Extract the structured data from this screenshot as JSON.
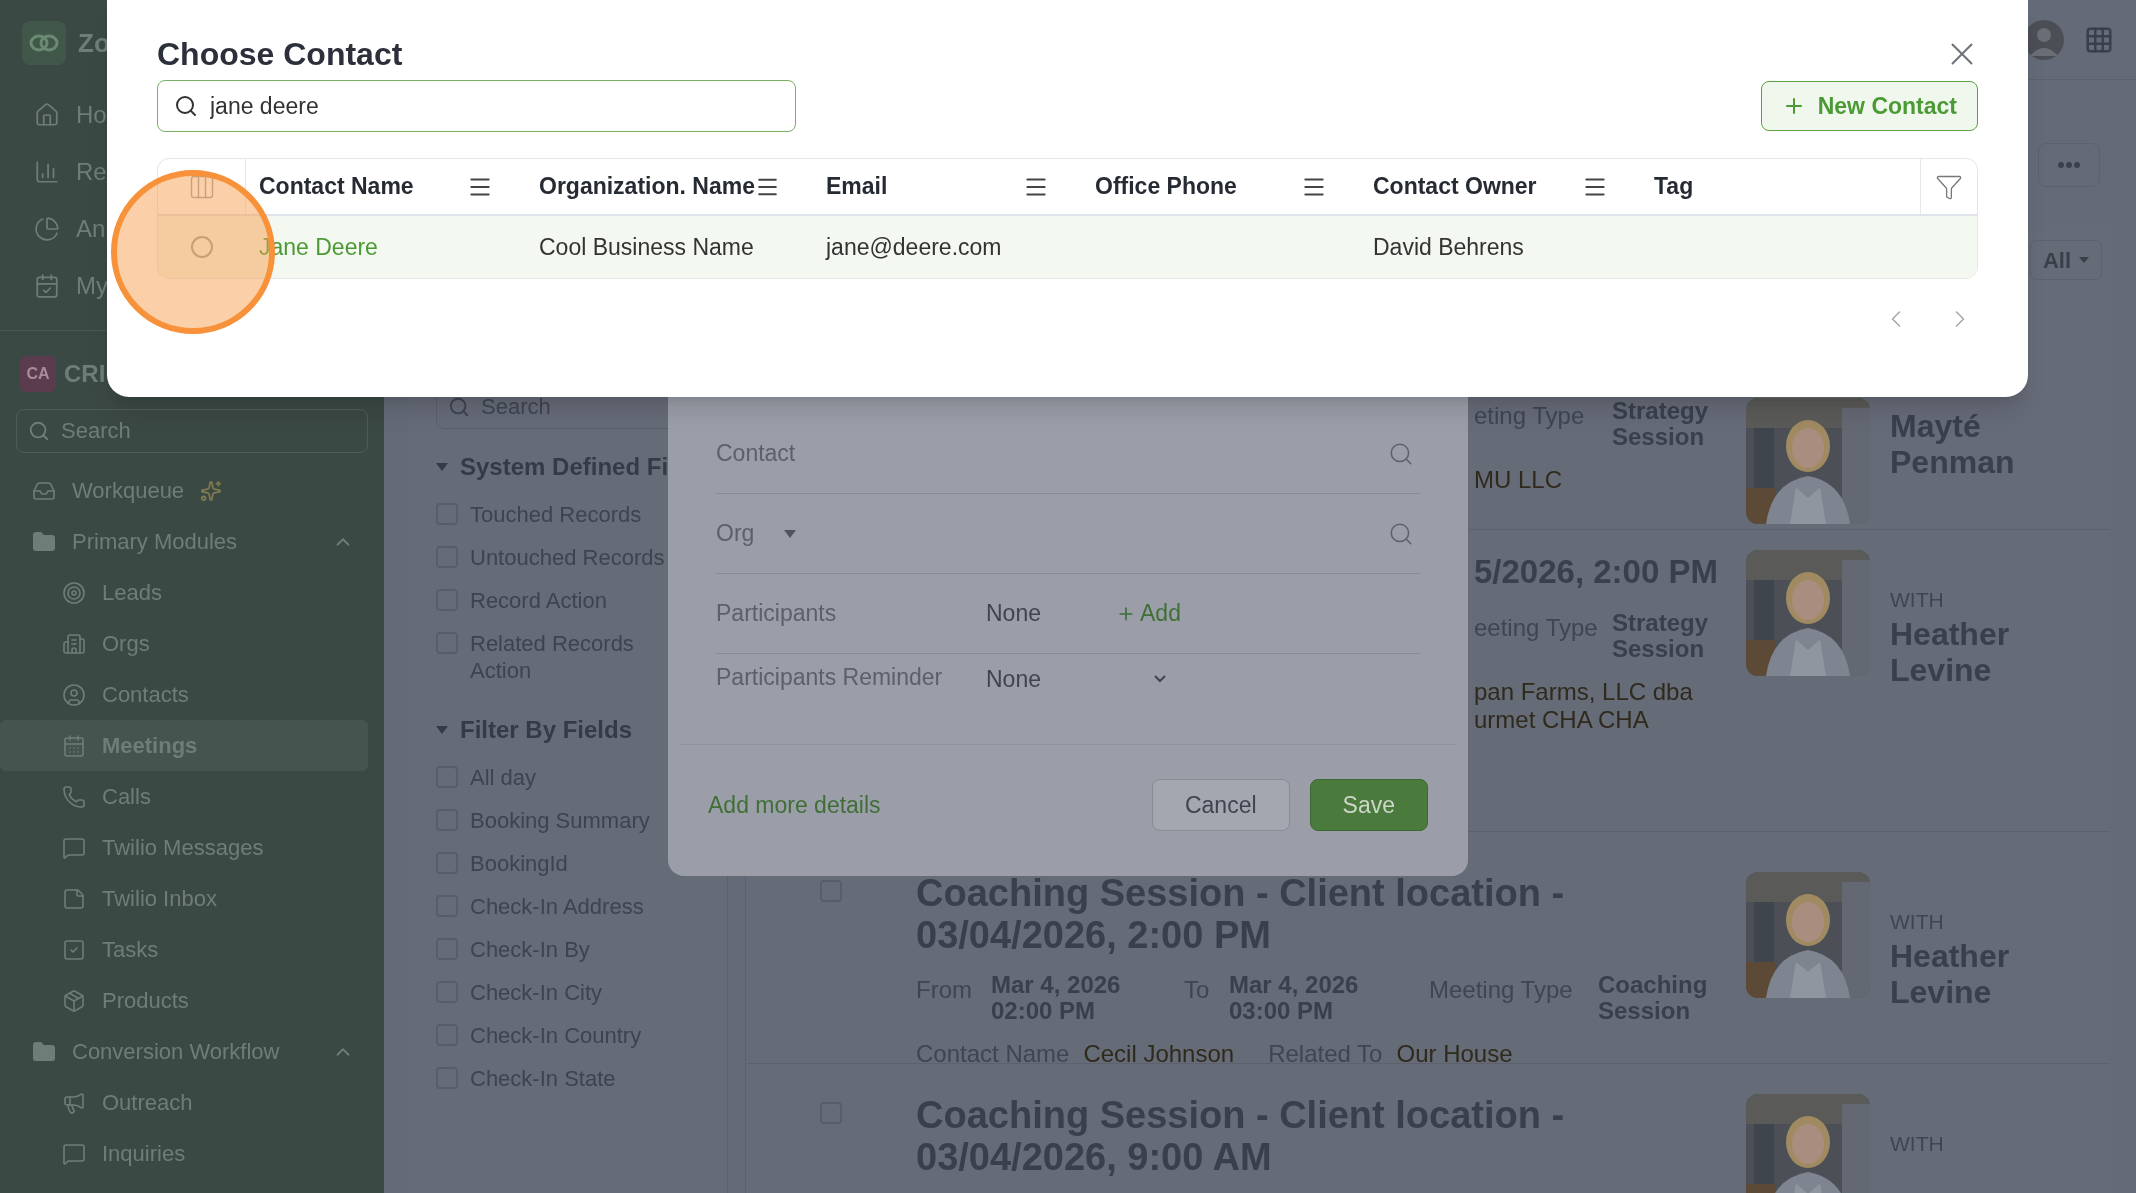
{
  "sidebar": {
    "app_name": "Zo",
    "top_items": [
      "Ho",
      "Re",
      "An",
      "My"
    ],
    "workspace": {
      "badge": "CA",
      "name": "CRI"
    },
    "search": {
      "placeholder": "Search"
    },
    "items": [
      {
        "label": "Workqueue",
        "kind": "link"
      },
      {
        "label": "Primary Modules",
        "kind": "group",
        "expanded": true,
        "children": [
          {
            "label": "Leads",
            "selected": false
          },
          {
            "label": "Orgs",
            "selected": false
          },
          {
            "label": "Contacts",
            "selected": false
          },
          {
            "label": "Meetings",
            "selected": true
          },
          {
            "label": "Calls",
            "selected": false
          },
          {
            "label": "Twilio Messages",
            "selected": false
          },
          {
            "label": "Twilio Inbox",
            "selected": false
          },
          {
            "label": "Tasks",
            "selected": false
          },
          {
            "label": "Products",
            "selected": false
          }
        ]
      },
      {
        "label": "Conversion Workflow",
        "kind": "group",
        "expanded": true,
        "children": [
          {
            "label": "Outreach",
            "selected": false
          },
          {
            "label": "Inquiries",
            "selected": false
          }
        ]
      }
    ]
  },
  "filters": {
    "search": {
      "placeholder": "Search"
    },
    "sections": [
      {
        "title": "System Defined Fi",
        "expanded": true,
        "items": [
          {
            "label": "Touched Records",
            "checked": false
          },
          {
            "label": "Untouched Records",
            "checked": false
          },
          {
            "label": "Record Action",
            "checked": false
          },
          {
            "label": "Related Records Action",
            "checked": false
          }
        ]
      },
      {
        "title": "Filter By Fields",
        "expanded": true,
        "items": [
          {
            "label": "All day",
            "checked": false
          },
          {
            "label": "Booking Summary",
            "checked": false
          },
          {
            "label": "BookingId",
            "checked": false
          },
          {
            "label": "Check-In Address",
            "checked": false
          },
          {
            "label": "Check-In By",
            "checked": false
          },
          {
            "label": "Check-In City",
            "checked": false
          },
          {
            "label": "Check-In Country",
            "checked": false
          },
          {
            "label": "Check-In State",
            "checked": false
          }
        ]
      }
    ]
  },
  "list_toolbar": {
    "view_select": "All"
  },
  "meetings": [
    {
      "kind": "covered",
      "fields": [
        {
          "label": "eting Type",
          "value": "Strategy Session"
        }
      ],
      "related": "MU LLC",
      "person": "Mayté Penman"
    },
    {
      "kind": "covered",
      "title": "5/2026, 2:00 PM",
      "fields": [
        {
          "label": "eeting Type",
          "value": "Strategy Session"
        }
      ],
      "related": "pan Farms, LLC dba urmet CHA CHA",
      "with_label": "WITH",
      "person": "Heather Levine"
    },
    {
      "kind": "full",
      "checked": false,
      "title": "Coaching Session - Client location - 03/04/2026, 2:00 PM",
      "from_label": "From",
      "from": "Mar 4, 2026 02:00 PM",
      "to_label": "To",
      "to": "Mar 4, 2026 03:00 PM",
      "fields": [
        {
          "label": "Meeting Type",
          "value": "Coaching Session"
        }
      ],
      "contact_label": "Contact Name",
      "contact": "Cecil Johnson",
      "related_label": "Related To",
      "related": "Our House",
      "with_label": "WITH",
      "person": "Heather Levine"
    },
    {
      "kind": "full",
      "checked": false,
      "title": "Coaching Session - Client location - 03/04/2026, 9:00 AM",
      "with_label": "WITH"
    }
  ],
  "meeting_form": {
    "fields": [
      {
        "label": "Contact",
        "kind": "lookup"
      },
      {
        "label": "Org",
        "kind": "lookup_dropdown"
      },
      {
        "label": "Participants",
        "kind": "participants",
        "value": "None",
        "action": "Add"
      },
      {
        "label": "Participants Reminder",
        "kind": "select",
        "value": "None"
      }
    ],
    "link": "Add more details",
    "buttons": [
      {
        "label": "Cancel",
        "kind": "secondary"
      },
      {
        "label": "Save",
        "kind": "primary"
      }
    ]
  },
  "dialog": {
    "title": "Choose Contact",
    "search": {
      "value": "jane deere"
    },
    "new_button": "New Contact",
    "table": {
      "columns": [
        "Contact Name",
        "Organization. Name",
        "Email",
        "Office Phone",
        "Contact Owner",
        "Tag"
      ],
      "rows": [
        {
          "selected": false,
          "cells": [
            "Jane Deere",
            "Cool Business Name",
            "jane@deere.com",
            null,
            "David Behrens",
            null
          ]
        }
      ]
    }
  },
  "annotation": {
    "kind": "circle"
  }
}
